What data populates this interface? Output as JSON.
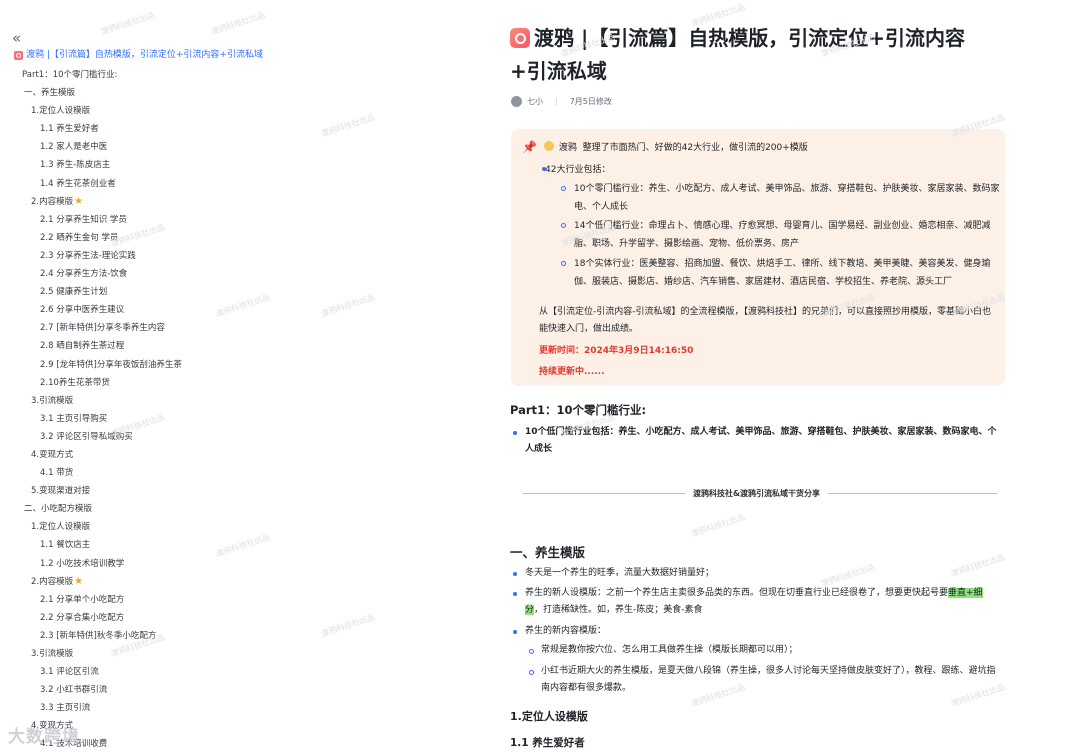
{
  "sidebar": {
    "collapse_glyph": "«",
    "title": "渡鸦 |【引流篇】自热模版，引流定位+引流内容+引流私域",
    "items": [
      {
        "label": "Part1：10个零门槛行业:",
        "level": 0
      },
      {
        "label": "一、养生模版",
        "level": 1
      },
      {
        "label": "1.定位人设模版",
        "level": 2
      },
      {
        "label": "1.1 养生爱好者",
        "level": 3
      },
      {
        "label": "1.2 家人是老中医",
        "level": 3
      },
      {
        "label": "1.3 养生-陈皮店主",
        "level": 3
      },
      {
        "label": "1.4 养生花茶创业者",
        "level": 3
      },
      {
        "label": "2.内容模版",
        "level": 2,
        "star": true
      },
      {
        "label": "2.1 分享养生知识 学员",
        "level": 3
      },
      {
        "label": "2.2 晒养生金句 学员",
        "level": 3
      },
      {
        "label": "2.3 分享养生法-理论实践",
        "level": 3
      },
      {
        "label": "2.4 分享养生方法-饮食",
        "level": 3
      },
      {
        "label": "2.5 健康养生计划",
        "level": 3
      },
      {
        "label": "2.6 分享中医养生建议",
        "level": 3
      },
      {
        "label": "2.7 [新年特供]分享冬季养生内容",
        "level": 3
      },
      {
        "label": "2.8 晒自制养生茶过程",
        "level": 3
      },
      {
        "label": "2.9 [龙年特供]分享年夜饭刮油养生茶",
        "level": 3
      },
      {
        "label": "2.10养生花茶带货",
        "level": 3
      },
      {
        "label": "3.引流模版",
        "level": 2
      },
      {
        "label": "3.1 主页引导购买",
        "level": 3
      },
      {
        "label": "3.2 评论区引导私域购买",
        "level": 3
      },
      {
        "label": "4.变现方式",
        "level": 2
      },
      {
        "label": "4.1 带货",
        "level": 3
      },
      {
        "label": "5.变现渠道对接",
        "level": 2
      },
      {
        "label": "二、小吃配方模版",
        "level": 1
      },
      {
        "label": "1.定位人设模版",
        "level": 2
      },
      {
        "label": "1.1 餐饮店主",
        "level": 3
      },
      {
        "label": "1.2 小吃技术培训教学",
        "level": 3
      },
      {
        "label": "2.内容模版",
        "level": 2,
        "star": true
      },
      {
        "label": "2.1 分享单个小吃配方",
        "level": 3
      },
      {
        "label": "2.2 分享合集小吃配方",
        "level": 3
      },
      {
        "label": "2.3 [新年特供]秋冬季小吃配方",
        "level": 3
      },
      {
        "label": "3.引流模版",
        "level": 2
      },
      {
        "label": "3.1 评论区引流",
        "level": 3
      },
      {
        "label": "3.2 小红书群引流",
        "level": 3
      },
      {
        "label": "3.3 主页引流",
        "level": 3
      },
      {
        "label": "4.变现方式",
        "level": 2
      },
      {
        "label": "4.1 技术培训收费",
        "level": 3
      }
    ],
    "bottom_mark": "大数跨境"
  },
  "doc": {
    "title": "渡鸦 |【引流篇】自热模版，引流定位+引流内容+引流私域",
    "author": "七小",
    "modified": "7月5日修改",
    "callout": {
      "head_name": "渡鸦",
      "head_text": "整理了市面热门、好做的42大行业，做引流的200+模版",
      "bullet": "42大行业包括：",
      "subs": [
        "10个零门槛行业：养生、小吃配方、成人考试、美甲饰品、旅游、穿搭鞋包、护肤美妆、家居家装、数码家电、个人成长",
        "14个低门槛行业：命理占卜、情感心理、疗愈冥想、母婴育儿、国学易经、副业创业、婚恋相亲、减肥减脂、职场、升学留学、摄影绘画、宠物、低价票务、房产",
        "18个实体行业：医美整容、招商加盟、餐饮、烘焙手工、律所、线下教培、美甲美睫、美容美发、健身瑜伽、服装店、摄影店、婚纱店、汽车销售、家居建材、酒店民宿、学校招生、养老院、源头工厂"
      ],
      "para": "从【引流定位-引流内容-引流私域】的全流程模版，【渡鸦科技社】的兄弟们，可以直接照抄用模版，零基础小白也能快速入门，做出成绩。",
      "update_time": "更新时间：2024年3月9日14:16:50",
      "continuing": "持续更新中......"
    },
    "part1_heading": "Part1：10个零门槛行业:",
    "part1_bullet": "10个低门槛行业包括：养生、小吃配方、成人考试、美甲饰品、旅游、穿搭鞋包、护肤美妆、家居家装、数码家电、个人成长",
    "divider_label": "渡鸦科技社&渡鸦引流私域干货分享",
    "section1_heading": "一、养生模版",
    "s1_bullets": {
      "b1": "冬天是一个养生的旺季，流量大数据好销量好；",
      "b2_pre": "养生的新人设模版：之前一个养生店主卖很多品类的东西。但现在切垂直行业已经很卷了，想要更快起号要",
      "b2_hl": "垂直+细分",
      "b2_post": "，打造稀缺性。如，养生-陈皮；美食-素食",
      "b3": "养生的新内容模版：",
      "s1": "常规是教你按穴位、怎么用工具做养生操（模版长期都可以用）；",
      "s2": "小红书近期大火的养生模版，是夏天做八段锦（养生操，很多人讨论每天坚持做皮肤变好了），教程、跟练、避坑指南内容都有很多爆款。"
    },
    "h_position": "1.定位人设模版",
    "h_11": "1.1 养生爱好者",
    "watermark": "渡鸦科技社出品"
  },
  "colors": {
    "accent": "#3370ff",
    "callout_bg": "#fdf0e6",
    "red": "#e03a2f",
    "highlight": "#8ee07c"
  }
}
